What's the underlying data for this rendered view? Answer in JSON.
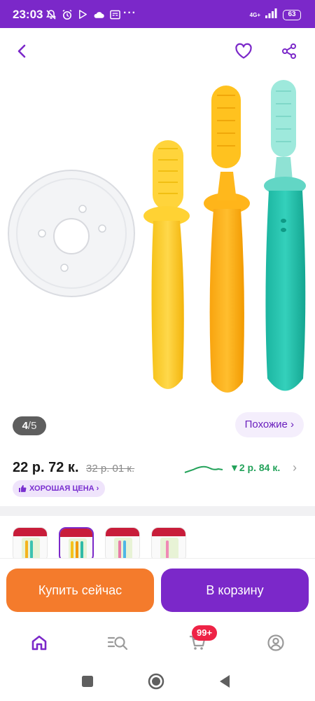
{
  "status_bar": {
    "time": "23:03",
    "network": "4G+",
    "battery": "63"
  },
  "icons": {
    "back": "back-arrow-icon",
    "favorite": "heart-icon",
    "share": "share-icon",
    "good_price": "thumb-up-icon",
    "nav": [
      "home-icon",
      "catalog-search-icon",
      "cart-icon",
      "profile-icon"
    ]
  },
  "gallery": {
    "current_photo": "4",
    "separator": "/",
    "total_photos": "5",
    "similar_label": "Похожие ›"
  },
  "price": {
    "current": "22 р. 72 к.",
    "old": "32 р. 01 к.",
    "drop": "▼2 р. 84 к.",
    "good_price_badge": "ХОРОШАЯ ЦЕНА ›"
  },
  "variants": {
    "selected_index": 1,
    "count": 4
  },
  "actions": {
    "buy_now": "Купить сейчас",
    "add_to_cart": "В корзину"
  },
  "bottom_nav": {
    "cart_badge": "99+",
    "active_tab": "home"
  },
  "colors": {
    "brand_purple": "#7b28c9",
    "buy_orange": "#f47b2c",
    "price_drop_green": "#23a25a",
    "badge_red": "#ee2346"
  }
}
